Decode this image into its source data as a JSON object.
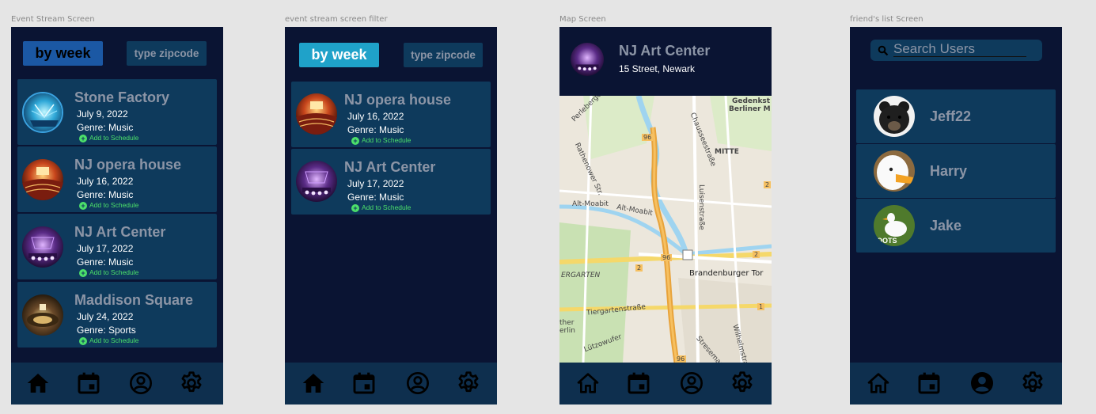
{
  "frames": {
    "event_stream": "Event Stream Screen",
    "event_filter": "event stream screen filter",
    "map": "Map Screen",
    "friends": "friend's list Screen"
  },
  "filters": {
    "by_week": "by week",
    "zipcode": "type zipcode"
  },
  "add_label": "Add to Schedule",
  "events": [
    {
      "name": "Stone Factory",
      "date": "July 9, 2022",
      "genre": "Genre: Music",
      "thumb": "stage-blue-icon"
    },
    {
      "name": "NJ opera house",
      "date": "July 16, 2022",
      "genre": "Genre: Music",
      "thumb": "opera-hall-icon"
    },
    {
      "name": "NJ Art Center",
      "date": "July 17, 2022",
      "genre": "Genre: Music",
      "thumb": "purple-stage-icon"
    },
    {
      "name": "Maddison Square",
      "date": "July 24, 2022",
      "genre": "Genre: Sports",
      "thumb": "arena-icon"
    }
  ],
  "filtered_events": [
    {
      "name": "NJ opera house",
      "date": "July 16, 2022",
      "genre": "Genre: Music"
    },
    {
      "name": "NJ Art Center",
      "date": "July 17, 2022",
      "genre": "Genre: Music"
    }
  ],
  "map": {
    "venue": "NJ Art Center",
    "address": "15 Street, Newark",
    "labels": {
      "chaussee": "Chausseestraße",
      "gedenk": "Gedenkst",
      "berliner": "Berliner M",
      "perleberger": "Perleberger St",
      "rathenower": "Rathenower Str.",
      "mitte": "MITTE",
      "altmoabit1": "Alt-Moabit",
      "altmoabit2": "Alt-Moabit",
      "luisen": "Luisenstraße",
      "garten": "ERGARTEN",
      "brandenburger": "Brandenburger Tor",
      "tiergarten": "Tiergartenstraße",
      "ther": "ther",
      "erlin": "erlin",
      "lutzow": "Lützowufer",
      "wilhelm": "Wilhelmstraße",
      "stresemann": "Stresemann",
      "r96a": "96",
      "r96b": "96",
      "r96c": "96",
      "r2a": "2",
      "r2b": "2",
      "r2c": "2",
      "r1": "1"
    }
  },
  "search": {
    "placeholder": "Search Users"
  },
  "friends": [
    {
      "name": "Jeff22",
      "avatar": "bear-icon"
    },
    {
      "name": "Harry",
      "avatar": "duck-icon"
    },
    {
      "name": "Jake",
      "avatar": "goose-icon",
      "caption": "OOTS"
    }
  ],
  "nav": [
    "home-icon",
    "calendar-icon",
    "profile-icon",
    "settings-icon"
  ],
  "colors": {
    "bg": "#0a1433",
    "card": "#0e3a5c",
    "accent": "#1b58a4",
    "accent_active": "#1fa2c9",
    "add_green": "#4ce06a"
  }
}
